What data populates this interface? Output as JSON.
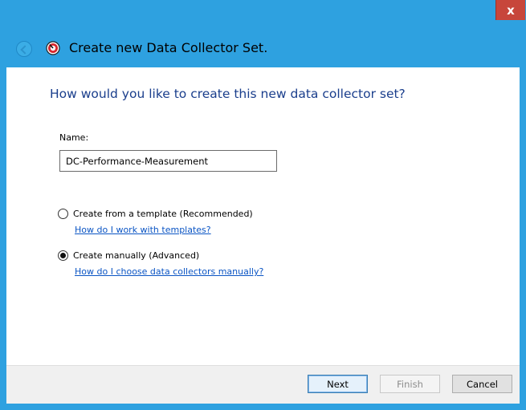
{
  "window": {
    "title": "Create new Data Collector Set.",
    "close_label": "x"
  },
  "main": {
    "heading": "How would you like to create this new data collector set?",
    "name_label": "Name:",
    "name_value": "DC-Performance-Measurement",
    "options": [
      {
        "label": "Create from a template (Recommended)",
        "link": "How do I work with templates?",
        "selected": false
      },
      {
        "label": "Create manually (Advanced)",
        "link": "How do I choose data collectors manually?",
        "selected": true
      }
    ]
  },
  "footer": {
    "next_label": "Next",
    "finish_label": "Finish",
    "cancel_label": "Cancel"
  },
  "colors": {
    "titlebar": "#2ea1e0",
    "close": "#c7463b",
    "heading": "#1a3e8c",
    "link": "#0b55c4"
  }
}
